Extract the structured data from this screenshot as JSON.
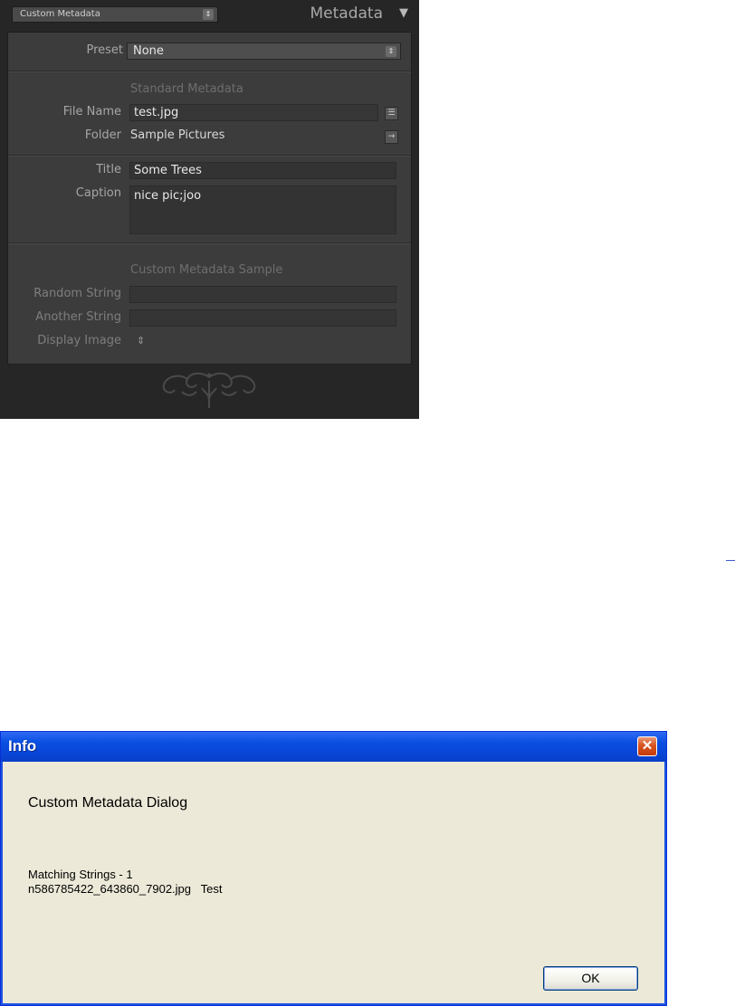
{
  "panel": {
    "dropdown_label": "Custom Metadata",
    "title": "Metadata",
    "collapse_glyph": "▼",
    "stepper_glyph": "⇕",
    "preset": {
      "label": "Preset",
      "value": "None"
    },
    "standard": {
      "section_title": "Standard Metadata",
      "file_name_label": "File Name",
      "file_name_value": "test.jpg",
      "folder_label": "Folder",
      "folder_value": "Sample Pictures",
      "file_name_button_icon": "list-icon",
      "folder_button_icon": "arrow-right-icon"
    },
    "descriptive": {
      "title_label": "Title",
      "title_value": "Some Trees",
      "caption_label": "Caption",
      "caption_value": "nice pic;joo"
    },
    "custom": {
      "section_title": "Custom Metadata Sample",
      "random_string_label": "Random String",
      "random_string_value": "",
      "another_string_label": "Another String",
      "another_string_value": "",
      "display_image_label": "Display Image",
      "display_image_glyph": "⇕"
    },
    "footer_icon": "ornament-scroll-icon"
  },
  "dialog": {
    "title": "Info",
    "close_glyph": "✕",
    "heading": "Custom Metadata Dialog",
    "matching_line": "Matching Strings - 1",
    "result_line": "n586785422_643860_7902.jpg   Test",
    "ok_label": "OK"
  },
  "colors": {
    "panel_bg": "#262626",
    "panel_body": "#3c3c3c",
    "xp_title_blue": "#0846d8",
    "xp_dialog_bg": "#ece9d8",
    "xp_close_red": "#d9541f"
  }
}
